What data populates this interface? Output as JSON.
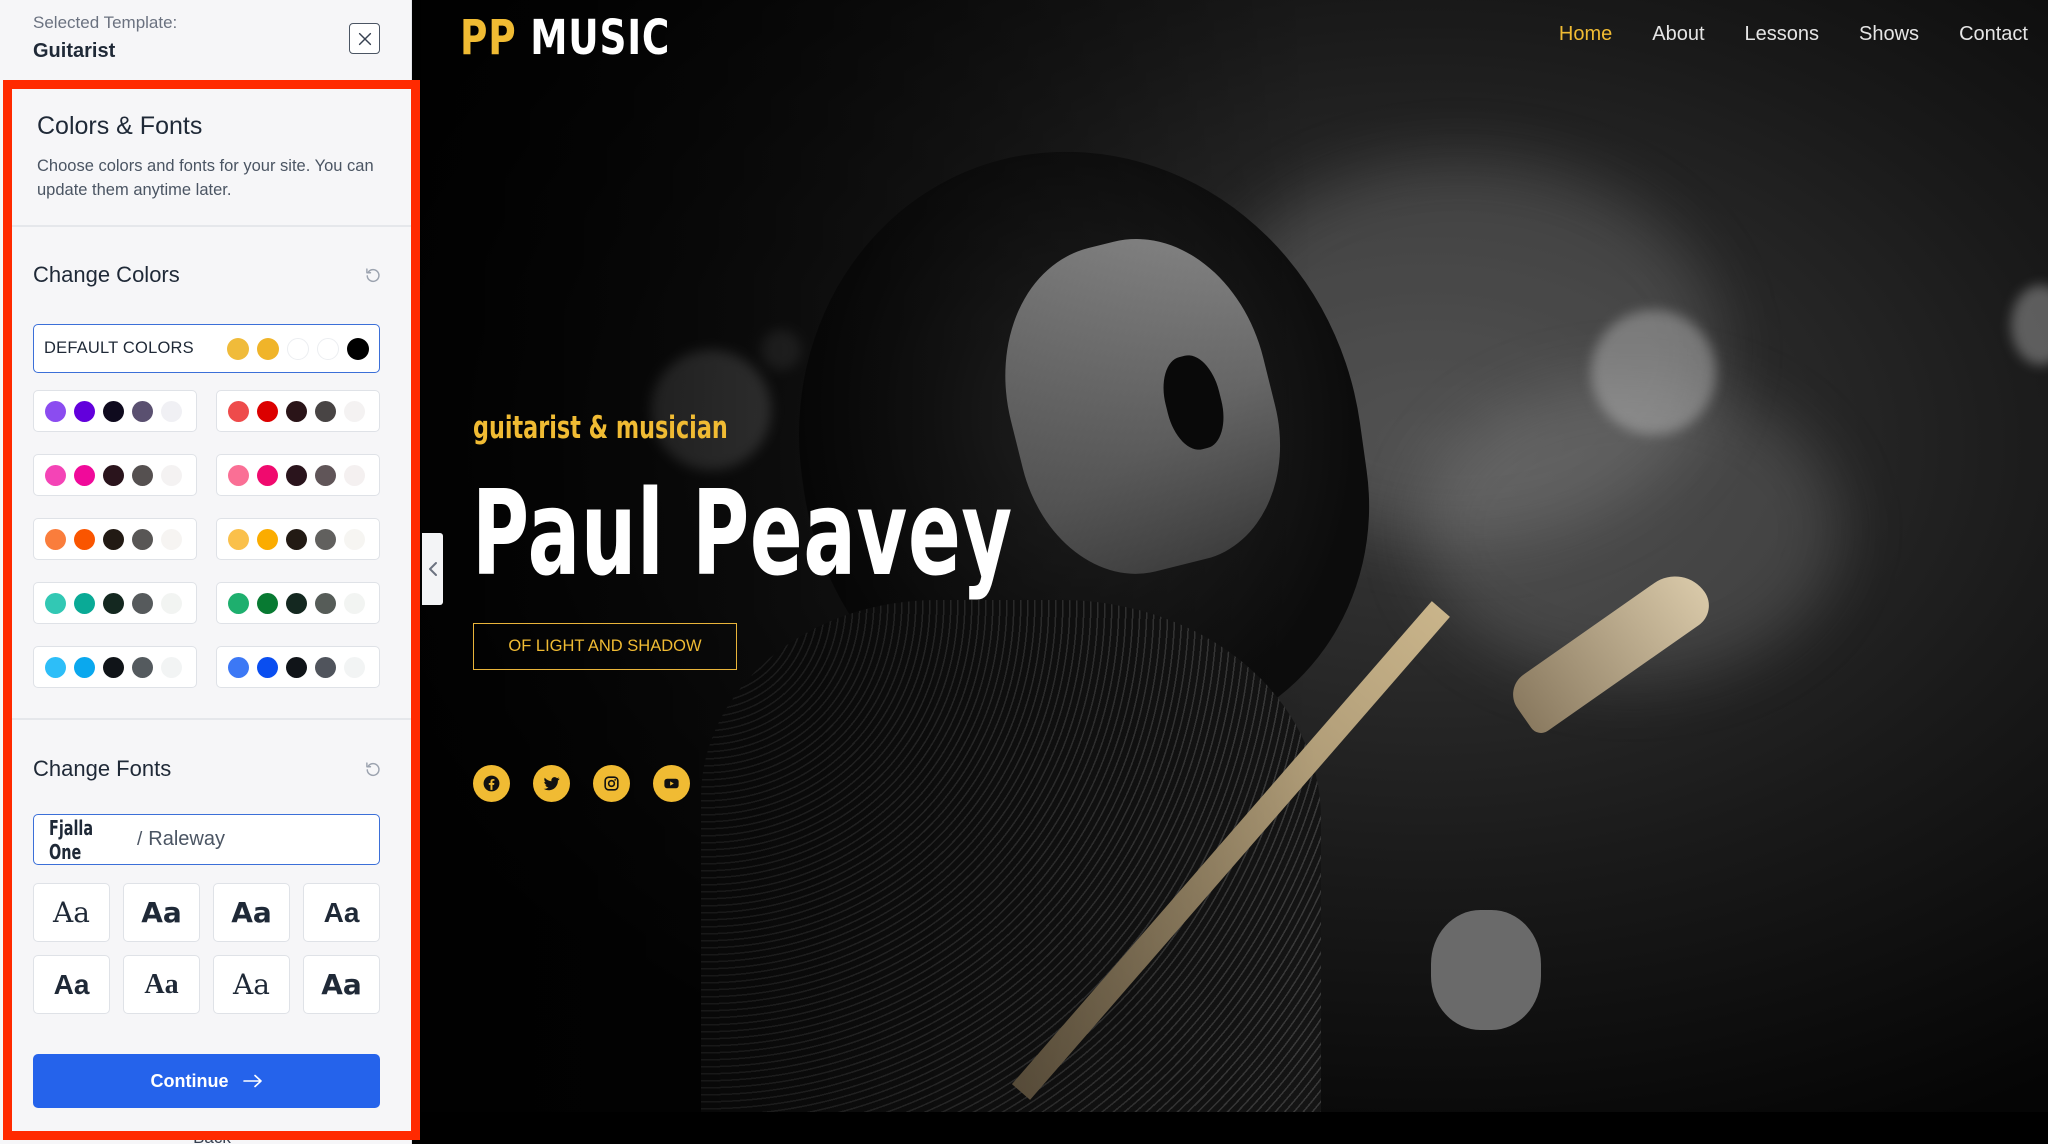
{
  "sidebar": {
    "selected_label": "Selected Template:",
    "selected_name": "Guitarist",
    "panel_title": "Colors & Fonts",
    "panel_description": "Choose colors and fonts for your site. You can update them anytime later.",
    "colors": {
      "title": "Change Colors",
      "default_label": "DEFAULT COLORS",
      "default_swatch": [
        "#f0bb3a",
        "#f0b429",
        "#ffffff",
        "#ffffff",
        "#000000"
      ],
      "palettes": [
        [
          "#8b4cf0",
          "#6200dc",
          "#0f0a1e",
          "#5a5070",
          "#f0f0f4"
        ],
        [
          "#ee4b4b",
          "#dc0000",
          "#2a1418",
          "#484444",
          "#f4f2f2"
        ],
        [
          "#f444b6",
          "#f00a9a",
          "#2a141c",
          "#555050",
          "#f4f2f2"
        ],
        [
          "#fa6f95",
          "#f00a6e",
          "#2a141c",
          "#605558",
          "#f4f0f0"
        ],
        [
          "#fa7d3c",
          "#fa5500",
          "#221a14",
          "#585655",
          "#f6f4f2"
        ],
        [
          "#fac04b",
          "#fbac00",
          "#221a14",
          "#61605e",
          "#f6f5f2"
        ],
        [
          "#32c8b4",
          "#0aaa96",
          "#142820",
          "#565a5c",
          "#f2f4f2"
        ],
        [
          "#1eaf6e",
          "#087a32",
          "#142820",
          "#565c58",
          "#f2f4f2"
        ],
        [
          "#2dbef8",
          "#0aa8ee",
          "#101418",
          "#545a5e",
          "#f2f4f4"
        ],
        [
          "#3c78f5",
          "#0a4ef0",
          "#101418",
          "#50545c",
          "#f2f4f4"
        ]
      ]
    },
    "fonts": {
      "title": "Change Fonts",
      "selected_primary": "Fjalla One",
      "separator": "/",
      "selected_secondary": "Raleway",
      "tiles": [
        "Aa",
        "Aa",
        "Aa",
        "Aa",
        "Aa",
        "Aa",
        "Aa",
        "Aa"
      ]
    },
    "continue_label": "Continue",
    "continue_icon": "arrow-right-icon",
    "back_label": "Back"
  },
  "preview": {
    "logo_part1": "PP",
    "logo_part2": "MUSIC",
    "nav": [
      "Home",
      "About",
      "Lessons",
      "Shows",
      "Contact"
    ],
    "active_nav": "Home",
    "tagline": "guitarist & musician",
    "name": "Paul Peavey",
    "cta": "OF LIGHT AND SHADOW",
    "socials": [
      "facebook-icon",
      "twitter-icon",
      "instagram-icon",
      "youtube-icon"
    ],
    "accent_color": "#f0bb33"
  },
  "ui_colors": {
    "highlight_border": "#ff2a00",
    "primary_button": "#2563eb"
  }
}
